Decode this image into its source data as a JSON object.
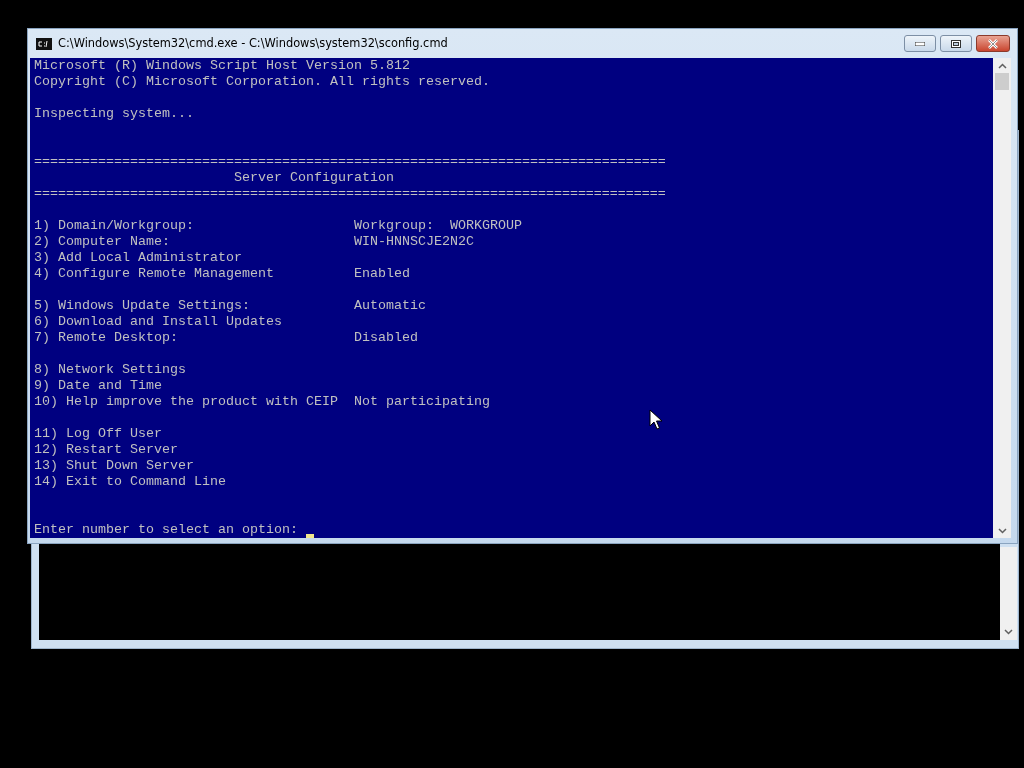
{
  "window": {
    "title": "C:\\Windows\\System32\\cmd.exe - C:\\Windows\\system32\\sconfig.cmd"
  },
  "console_lines": [
    {
      "kind": "text",
      "text": "Microsoft (R) Windows Script Host Version 5.812"
    },
    {
      "kind": "text",
      "text": "Copyright (C) Microsoft Corporation. All rights reserved."
    },
    {
      "kind": "blank"
    },
    {
      "kind": "text",
      "text": "Inspecting system..."
    },
    {
      "kind": "blank"
    },
    {
      "kind": "blank"
    },
    {
      "kind": "rule",
      "text": "==============================================================================="
    },
    {
      "kind": "heading",
      "text": "Server Configuration"
    },
    {
      "kind": "rule",
      "text": "==============================================================================="
    },
    {
      "kind": "blank"
    },
    {
      "kind": "option",
      "label": "1) Domain/Workgroup:",
      "value": "Workgroup:  WORKGROUP"
    },
    {
      "kind": "option",
      "label": "2) Computer Name:",
      "value": "WIN-HNNSCJE2N2C"
    },
    {
      "kind": "option",
      "label": "3) Add Local Administrator"
    },
    {
      "kind": "option",
      "label": "4) Configure Remote Management",
      "value": "Enabled"
    },
    {
      "kind": "blank"
    },
    {
      "kind": "option",
      "label": "5) Windows Update Settings:",
      "value": "Automatic"
    },
    {
      "kind": "option",
      "label": "6) Download and Install Updates"
    },
    {
      "kind": "option",
      "label": "7) Remote Desktop:",
      "value": "Disabled"
    },
    {
      "kind": "blank"
    },
    {
      "kind": "option",
      "label": "8) Network Settings"
    },
    {
      "kind": "option",
      "label": "9) Date and Time"
    },
    {
      "kind": "option",
      "label": "10) Help improve the product with CEIP",
      "value": "Not participating"
    },
    {
      "kind": "blank"
    },
    {
      "kind": "option",
      "label": "11) Log Off User"
    },
    {
      "kind": "option",
      "label": "12) Restart Server"
    },
    {
      "kind": "option",
      "label": "13) Shut Down Server"
    },
    {
      "kind": "option",
      "label": "14) Exit to Command Line"
    },
    {
      "kind": "blank"
    },
    {
      "kind": "blank"
    },
    {
      "kind": "prompt",
      "text": "Enter number to select an option:"
    }
  ]
}
